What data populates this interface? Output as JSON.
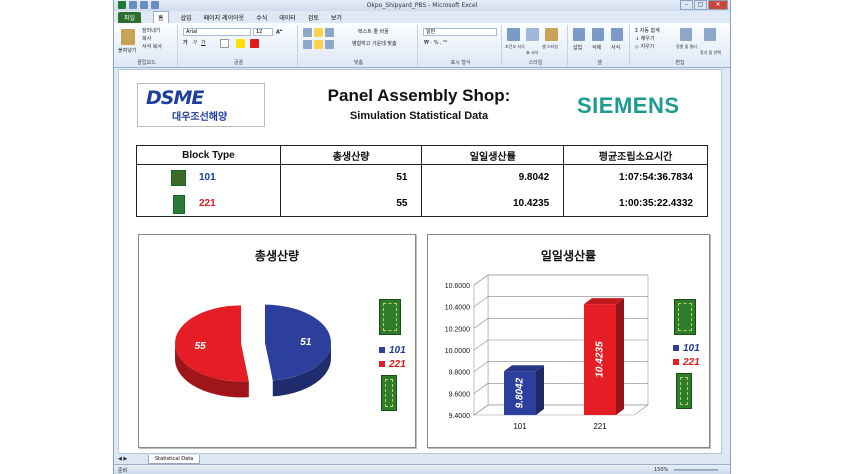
{
  "window": {
    "title": "Okpo_Shipyard_PBS - Microsoft Excel",
    "minimize": "–",
    "maximize": "□",
    "close": "✕"
  },
  "ribbon_tabs": [
    "파일",
    "홈",
    "삽입",
    "페이지 레이아웃",
    "수식",
    "데이터",
    "검토",
    "보기"
  ],
  "ribbon": {
    "font_name": "Arial",
    "font_size": "12",
    "number_format": "일반",
    "groups": [
      "클립보드",
      "글꼴",
      "맞춤",
      "표시 형식",
      "스타일",
      "셀",
      "편집"
    ],
    "paste": "붙여넣기",
    "cut": "잘라내기",
    "copy": "복사",
    "format_painter": "서식 복사",
    "wrap_text": "텍스트 줄 바꿈",
    "merge_center": "병합하고 가운데 맞춤",
    "cond_format": "조건부 서식",
    "table_format": "표 서식",
    "cell_styles": "셀 스타일",
    "insert": "삽입",
    "delete": "삭제",
    "format": "서식",
    "autosum": "자동 합계",
    "fill": "채우기",
    "clear": "지우기",
    "sort": "정렬 및 필터",
    "find": "찾기 및 선택"
  },
  "sheet": {
    "logo_left_en": "DSME",
    "logo_left_kr": "대우조선해양",
    "title": "Panel Assembly Shop:",
    "subtitle": "Simulation Statistical Data",
    "logo_right": "SIEMENS",
    "table": {
      "headers": [
        "Block Type",
        "총생산량",
        "일일생산률",
        "평균조립소요시간"
      ],
      "rows": [
        {
          "type": "101",
          "total": "51",
          "daily": "9.8042",
          "avg_time": "1:07:54:36.7834",
          "color": "#1f3aa0"
        },
        {
          "type": "221",
          "total": "55",
          "daily": "10.4235",
          "avg_time": "1:00:35:22.4332",
          "color": "#e01b1b"
        }
      ]
    }
  },
  "chart_data": [
    {
      "type": "pie",
      "title": "총생산량",
      "categories": [
        "101",
        "221"
      ],
      "values": [
        51,
        55
      ],
      "colors": [
        "#2d3f9c",
        "#e51e25"
      ],
      "legend": "right"
    },
    {
      "type": "bar",
      "title": "일일생산률",
      "categories": [
        "101",
        "221"
      ],
      "values": [
        9.8042,
        10.4235
      ],
      "data_labels": [
        "9.8042",
        "10.4235"
      ],
      "colors": [
        "#2d3f9c",
        "#e51e25"
      ],
      "ylim": [
        9.4,
        10.6
      ],
      "yticks": [
        "9.4000",
        "9.6000",
        "9.8000",
        "10.0000",
        "10.2000",
        "10.4000",
        "10.6000"
      ],
      "grid": true,
      "legend": "right"
    }
  ],
  "sheet_tab": "Statistical Data",
  "status": {
    "ready": "준비",
    "zoom": "150%"
  }
}
